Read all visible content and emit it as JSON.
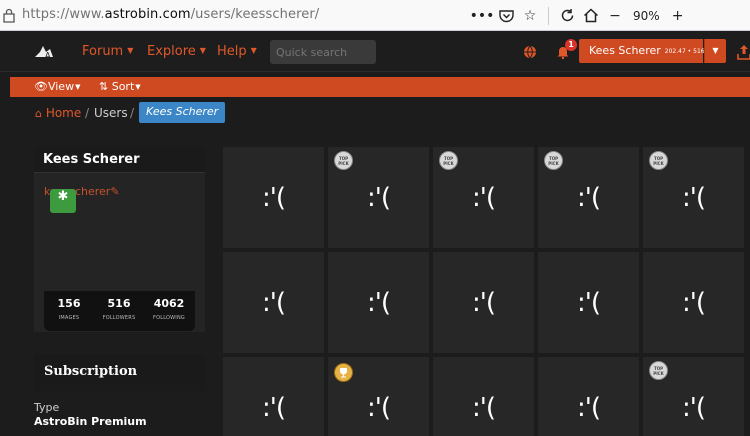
{
  "browser": {
    "url_prefix": "https://www.",
    "url_domain": "astrobin.com",
    "url_path": "/users/keesscherer/",
    "zoom": "90%"
  },
  "nav": {
    "forum": "Forum",
    "explore": "Explore",
    "help": "Help",
    "search_placeholder": "Quick search",
    "notification_count": "1",
    "user_name": "Kees Scherer",
    "user_stats": "202.47 • 516"
  },
  "subnav": {
    "view": "View",
    "sort": "Sort"
  },
  "breadcrumb": {
    "home": "Home",
    "users": "Users",
    "current": "Kees Scherer"
  },
  "profile": {
    "title": "Kees Scherer",
    "username": "keesscherer",
    "stats": [
      {
        "value": "156",
        "label": "IMAGES"
      },
      {
        "value": "516",
        "label": "FOLLOWERS"
      },
      {
        "value": "4062",
        "label": "FOLLOWING"
      }
    ]
  },
  "subscription": {
    "title": "Subscription",
    "type_label": "Type",
    "type_value": "AstroBin Premium"
  },
  "grid": {
    "placeholder": ":'(",
    "toppick_label": "TOP PICK",
    "tiles": [
      {
        "badge": ""
      },
      {
        "badge": "toppick"
      },
      {
        "badge": "toppick"
      },
      {
        "badge": "toppick"
      },
      {
        "badge": "toppick"
      },
      {
        "badge": ""
      },
      {
        "badge": ""
      },
      {
        "badge": ""
      },
      {
        "badge": ""
      },
      {
        "badge": ""
      },
      {
        "badge": ""
      },
      {
        "badge": "trophy"
      },
      {
        "badge": ""
      },
      {
        "badge": ""
      },
      {
        "badge": "toppick"
      }
    ]
  },
  "colors": {
    "accent": "#cf4a21",
    "link": "#e0582a",
    "breadcrumb_active": "#3a86c6",
    "avatar": "#3e9a3e"
  }
}
